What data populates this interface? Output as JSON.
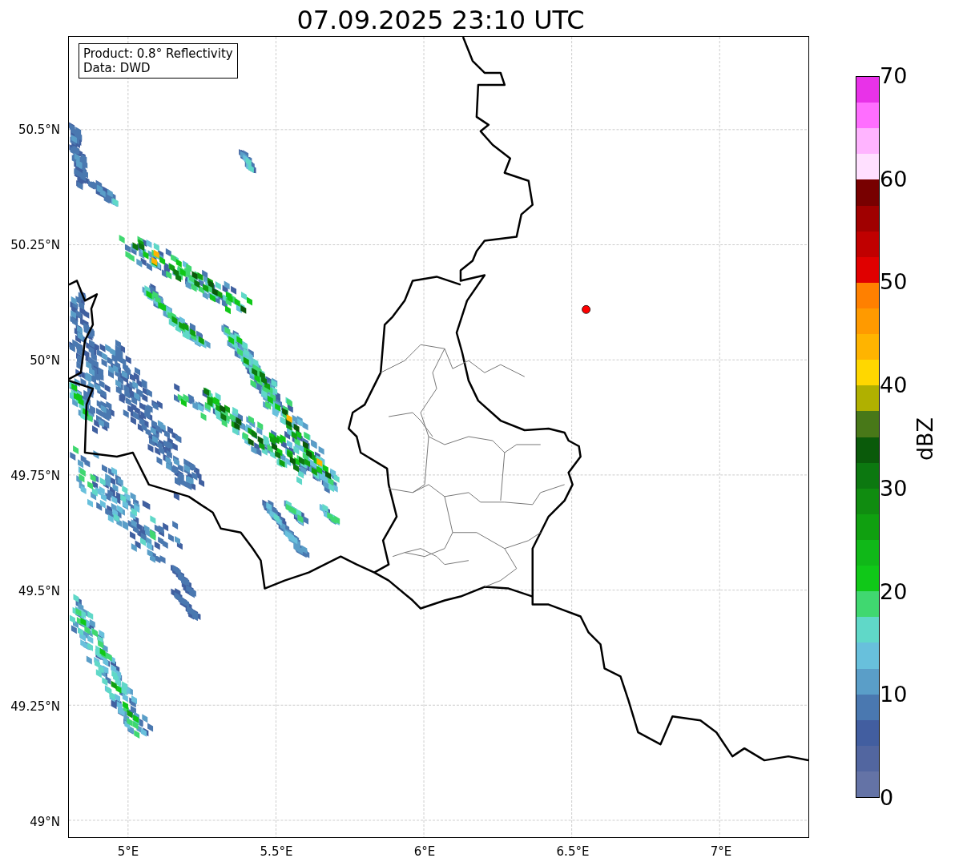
{
  "title": "07.09.2025 23:10 UTC",
  "map": {
    "legend": [
      "Product: 0.8° Reflectivity",
      "Data: DWD"
    ],
    "x_tick_labels": [
      "5°E",
      "5.5°E",
      "6°E",
      "6.5°E",
      "7°E"
    ],
    "y_tick_labels": [
      "50.5°N",
      "50.25°N",
      "50°N",
      "49.75°N",
      "49.5°N",
      "49.25°N",
      "49°N"
    ]
  },
  "colorbar": {
    "label": "dBZ",
    "tick_labels": [
      "70",
      "60",
      "50",
      "40",
      "30",
      "20",
      "10",
      "0"
    ],
    "bins": [
      {
        "color": "#e832e8"
      },
      {
        "color": "#ff6eff"
      },
      {
        "color": "#ffb4ff"
      },
      {
        "color": "#ffe0ff"
      },
      {
        "color": "#780000"
      },
      {
        "color": "#a00000"
      },
      {
        "color": "#c00000"
      },
      {
        "color": "#e00000"
      },
      {
        "color": "#ff8000"
      },
      {
        "color": "#ff9a00"
      },
      {
        "color": "#ffb400"
      },
      {
        "color": "#ffd700"
      },
      {
        "color": "#b0b000"
      },
      {
        "color": "#487818"
      },
      {
        "color": "#0a5a0a"
      },
      {
        "color": "#0c7810"
      },
      {
        "color": "#108c10"
      },
      {
        "color": "#10a010"
      },
      {
        "color": "#10b818"
      },
      {
        "color": "#10c818"
      },
      {
        "color": "#40d870"
      },
      {
        "color": "#60d8c8"
      },
      {
        "color": "#68c0dc"
      },
      {
        "color": "#5a9ec8"
      },
      {
        "color": "#4a78b0"
      },
      {
        "color": "#425ea0"
      },
      {
        "color": "#5266a0"
      },
      {
        "color": "#6473a6"
      }
    ]
  }
}
